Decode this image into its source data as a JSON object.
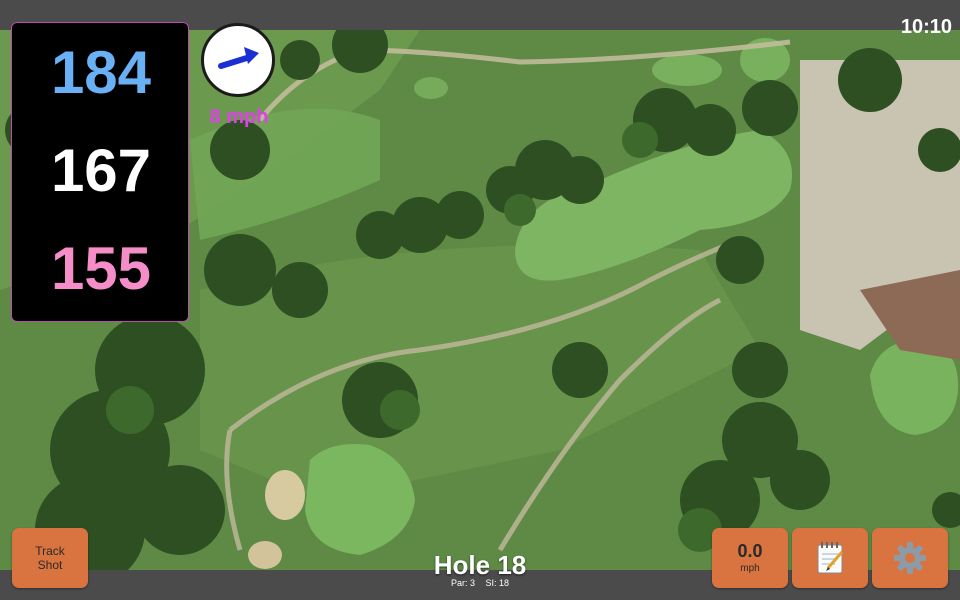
{
  "status_bar": {
    "time": "10:10"
  },
  "distances": {
    "back": "184",
    "middle": "167",
    "front": "155"
  },
  "wind": {
    "speed_label": "8 mph",
    "icon": "wind-arrow-icon"
  },
  "controls": {
    "track_shot_line1": "Track",
    "track_shot_line2": "Shot",
    "shot_speed_value": "0.0",
    "shot_speed_unit": "mph",
    "notes_icon": "notepad-icon",
    "settings_icon": "gear-icon"
  },
  "hole": {
    "title": "Hole 18",
    "par_label": "Par: 3",
    "si_label": "SI: 18"
  },
  "colors": {
    "back_distance": "#6ab0f5",
    "middle_distance": "#ffffff",
    "front_distance": "#f58ec8",
    "wind_text": "#e040e8",
    "button": "#d9733f"
  }
}
